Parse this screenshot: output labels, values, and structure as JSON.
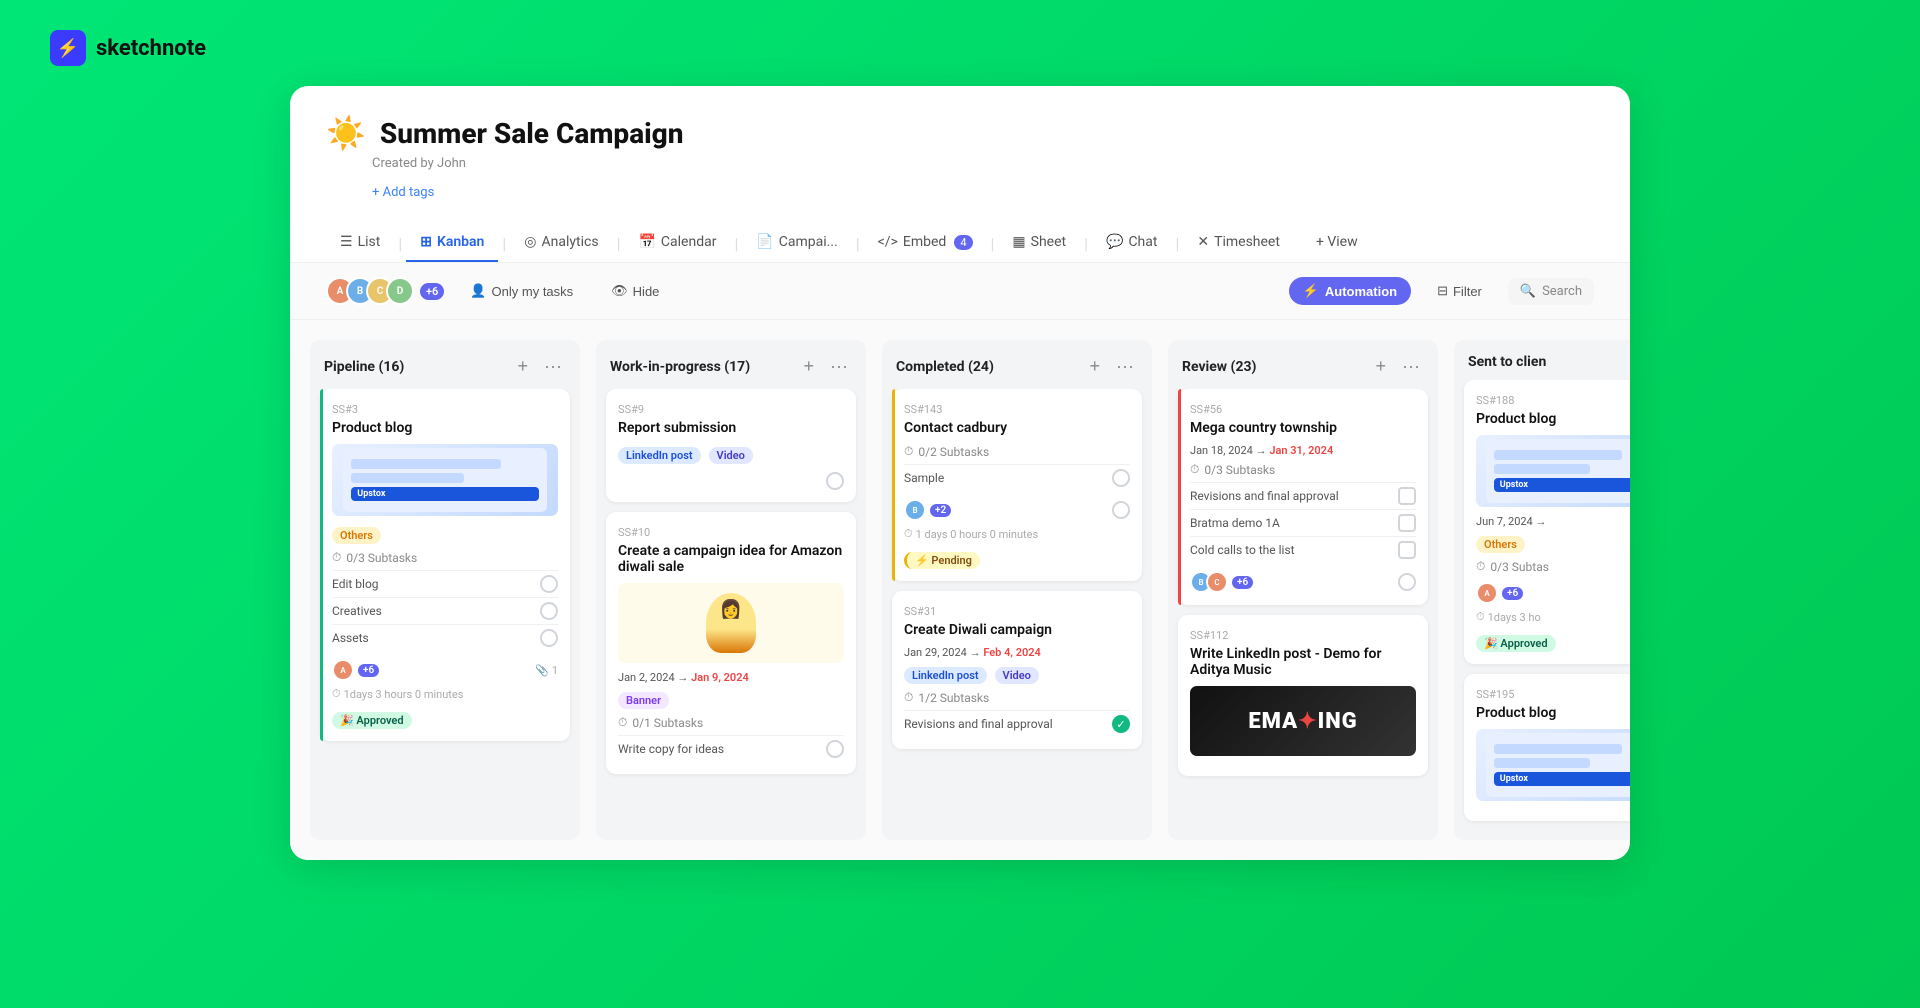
{
  "app": {
    "name": "sketchnote",
    "logo_icon": "⚡"
  },
  "project": {
    "emoji": "☀️",
    "title": "Summer Sale Campaign",
    "created_by": "Created by John",
    "add_tags_label": "+ Add tags"
  },
  "tabs": [
    {
      "id": "list",
      "label": "List",
      "icon": "☰",
      "active": false
    },
    {
      "id": "kanban",
      "label": "Kanban",
      "icon": "⊞",
      "active": true
    },
    {
      "id": "analytics",
      "label": "Analytics",
      "icon": "◎",
      "active": false
    },
    {
      "id": "calendar",
      "label": "Calendar",
      "icon": "📅",
      "active": false
    },
    {
      "id": "campaign",
      "label": "Campai...",
      "icon": "📄",
      "active": false
    },
    {
      "id": "embed",
      "label": "Embed",
      "icon": "</>",
      "active": false,
      "badge": "4"
    },
    {
      "id": "sheet",
      "label": "Sheet",
      "icon": "▦",
      "active": false
    },
    {
      "id": "chat",
      "label": "Chat",
      "icon": "💬",
      "active": false
    },
    {
      "id": "timesheet",
      "label": "Timesheet",
      "icon": "✕",
      "active": false
    },
    {
      "id": "view",
      "label": "+ View",
      "icon": "",
      "active": false
    }
  ],
  "toolbar": {
    "only_my_tasks": "Only my tasks",
    "hide": "Hide",
    "automation": "Automation",
    "filter": "Filter",
    "search_placeholder": "Search",
    "avatar_count": "+6"
  },
  "columns": [
    {
      "id": "pipeline",
      "title": "Pipeline",
      "count": 16,
      "cards": [
        {
          "id": "SS#3",
          "title": "Product blog",
          "has_image": true,
          "image_type": "upstox",
          "tags": [
            "Others"
          ],
          "subtasks": "0/3 Subtasks",
          "task_items": [
            {
              "label": "Edit blog",
              "done": false
            },
            {
              "label": "Creatives",
              "done": false
            },
            {
              "label": "Assets",
              "done": false
            }
          ],
          "avatar_count": "+6",
          "has_attachment": true,
          "attachment_count": "1",
          "time": "1days 3 hours 0 minutes",
          "status_tag": "Approved",
          "border_color": "green"
        }
      ]
    },
    {
      "id": "wip",
      "title": "Work-in-progress",
      "count": 17,
      "cards": [
        {
          "id": "SS#9",
          "title": "Report submission",
          "tags": [
            "LinkedIn post",
            "Video"
          ],
          "border_color": "none"
        },
        {
          "id": "SS#10",
          "title": "Create a campaign idea for Amazon diwali sale",
          "has_image": true,
          "image_type": "amazon",
          "date_start": "Jan 2, 2024",
          "date_end": "Jan 9, 2024",
          "date_overdue": true,
          "tags": [
            "Banner"
          ],
          "subtasks": "0/1 Subtasks",
          "task_items": [
            {
              "label": "Write copy for ideas",
              "done": false
            }
          ],
          "border_color": "none"
        }
      ]
    },
    {
      "id": "completed",
      "title": "Completed",
      "count": 24,
      "cards": [
        {
          "id": "SS#143",
          "title": "Contact cadbury",
          "subtasks": "0/2 Subtasks",
          "task_items": [
            {
              "label": "Sample",
              "done": false
            }
          ],
          "avatar_count": "+2",
          "time": "1 days 0 hours 0 minutes",
          "status_tag": "Pending",
          "border_color": "yellow"
        },
        {
          "id": "SS#31",
          "title": "Create Diwali campaign",
          "date_start": "Jan 29, 2024",
          "date_end": "Feb 4, 2024",
          "date_overdue": true,
          "tags": [
            "LinkedIn post",
            "Video"
          ],
          "subtasks": "1/2 Subtasks",
          "task_items": [
            {
              "label": "Revisions and final approval",
              "done": true
            }
          ],
          "border_color": "none"
        }
      ]
    },
    {
      "id": "review",
      "title": "Review",
      "count": 23,
      "cards": [
        {
          "id": "SS#56",
          "title": "Mega country township",
          "date_start": "Jan 18, 2024",
          "date_end": "Jan 31, 2024",
          "date_overdue": true,
          "subtasks": "0/3 Subtasks",
          "task_items": [
            {
              "label": "Revisions and final approval",
              "done": false
            },
            {
              "label": "Bratma demo 1A",
              "done": false
            },
            {
              "label": "Cold calls to the list",
              "done": false
            }
          ],
          "avatar_count": "+6",
          "border_color": "red"
        },
        {
          "id": "SS#112",
          "title": "Write LinkedIn post - Demo for Aditya Music",
          "has_image": true,
          "image_type": "emaling",
          "border_color": "none"
        }
      ]
    },
    {
      "id": "sent_to_client",
      "title": "Sent to clien",
      "count": null,
      "cards": [
        {
          "id": "SS#188",
          "title": "Product blog",
          "has_image": true,
          "image_type": "upstox",
          "date_start": "Jun 7, 2024",
          "date_end": null,
          "tags": [
            "Others"
          ],
          "subtasks": "0/3 Subtas",
          "avatar_count": "+6",
          "time": "1days 3 ho",
          "status_tag": "Approved",
          "border_color": "none"
        },
        {
          "id": "SS#195",
          "title": "Product blog",
          "has_image": true,
          "image_type": "upstox",
          "border_color": "none"
        }
      ]
    }
  ]
}
